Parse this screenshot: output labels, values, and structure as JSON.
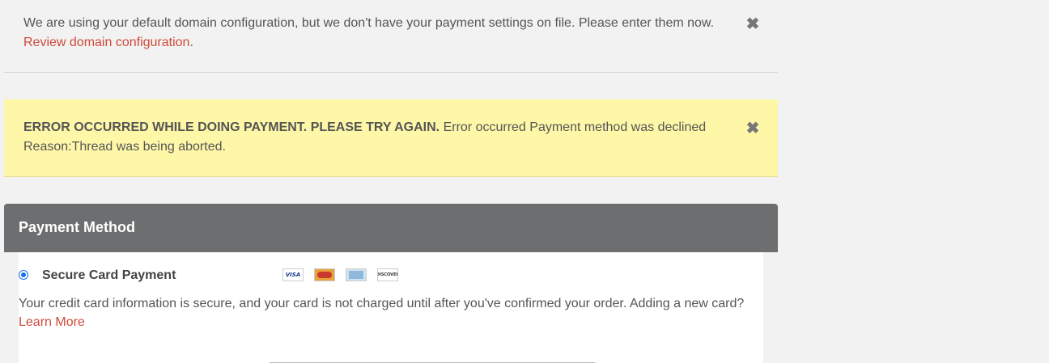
{
  "notice": {
    "text": "We are using your default domain configuration, but we don't have your payment settings on file. Please enter them now. ",
    "link": "Review domain configuration",
    "after_link": ".",
    "close_glyph": "✖"
  },
  "error": {
    "strong": "ERROR OCCURRED WHILE DOING PAYMENT. PLEASE TRY AGAIN.",
    "message": " Error occurred Payment method was declined Reason:Thread was being aborted.",
    "close_glyph": "✖"
  },
  "payment": {
    "title": "Payment Method",
    "option_label": "Secure Card Payment",
    "option_selected": true,
    "cards": [
      "VISA",
      "MasterCard",
      "American Express",
      "DISCOVER"
    ],
    "description": "Your credit card information is secure, and your card is not charged until after you've confirmed your order. Adding a new card? ",
    "learn_more": "Learn More"
  },
  "colors": {
    "link": "#d04a3a",
    "error_bg": "#fef7a8",
    "header_bg": "#6d6e70",
    "radio": "#1a73e8"
  }
}
